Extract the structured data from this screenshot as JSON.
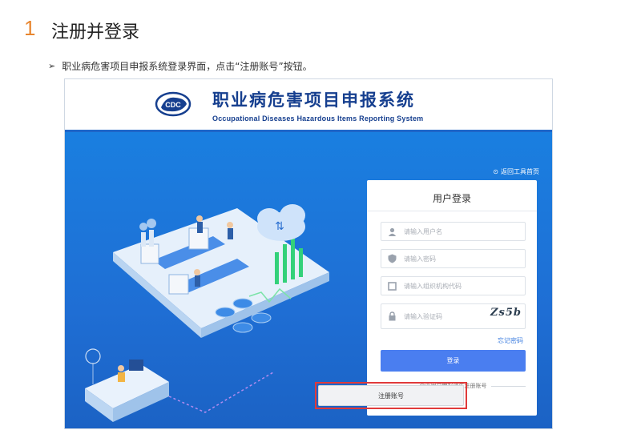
{
  "doc": {
    "section_number": "1",
    "section_title": "注册并登录",
    "bullet": "职业病危害项目申报系统登录界面，点击“注册账号”按钮。"
  },
  "system": {
    "title_cn": "职业病危害项目申报系统",
    "title_en": "Occupational Diseases Hazardous Items Reporting System",
    "logo_text": "CDC",
    "topright_link": "返回工具首页"
  },
  "login": {
    "title": "用户登录",
    "username_placeholder": "请输入用户名",
    "password_placeholder": "请输入密码",
    "org_placeholder": "请输入组织机构代码",
    "captcha_placeholder": "请输入验证码",
    "captcha_text": "Zs5b",
    "forgot_label": "忘记密码",
    "login_button": "登录",
    "divider_text": "企业用户申报请先注册账号",
    "register_button": "注册账号"
  },
  "colors": {
    "accent_orange": "#e8862f",
    "brand_blue": "#163f8f",
    "hero_blue": "#1f6ed4",
    "button_blue": "#4a7ef0",
    "highlight_red": "#e03a3a"
  }
}
